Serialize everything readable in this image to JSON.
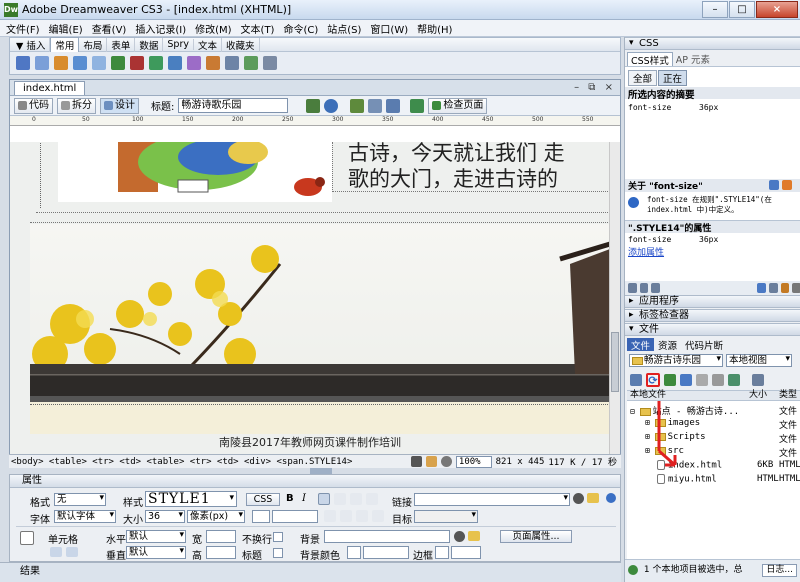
{
  "window": {
    "title": "Adobe Dreamweaver CS3 - [index.html (XHTML)]",
    "app_icon_label": "Dw",
    "minimize": "–",
    "maximize": "□",
    "close": "×"
  },
  "menu": [
    "文件(F)",
    "编辑(E)",
    "查看(V)",
    "插入记录(I)",
    "修改(M)",
    "文本(T)",
    "命令(C)",
    "站点(S)",
    "窗口(W)",
    "帮助(H)"
  ],
  "insert_panel": {
    "toggle": "▼ 插入",
    "tabs": [
      "常用",
      "布局",
      "表单",
      "数据",
      "Spry",
      "文本",
      "收藏夹"
    ],
    "active_tab": "常用"
  },
  "document": {
    "tab_name": "index.html",
    "window_controls": "– ⧉ ×",
    "view_buttons": [
      "代码",
      "拆分",
      "设计"
    ],
    "title_label": "标题:",
    "title_value": "畅游诗歌乐园",
    "check_page": "检查页面",
    "ruler_marks": [
      "0",
      "50",
      "100",
      "150",
      "200",
      "250",
      "300",
      "350",
      "400",
      "450",
      "500",
      "550"
    ],
    "heading_line1": "古诗，今天就让我们 走",
    "heading_line2": "歌的大门，走进古诗的",
    "footer_text": "南陵县2017年教师网页课件制作培训"
  },
  "status_bar": {
    "tag_path": "<body> <table> <tr> <td> <table> <tr> <td> <div> <span.STYLE14>",
    "zoom": "100%",
    "size": "821 x 445",
    "file_info": "117 K / 17 秒"
  },
  "properties": {
    "header": "属性",
    "format_label": "格式",
    "format_value": "无",
    "style_label": "样式",
    "style_value": "STYLE1",
    "css_button": "CSS",
    "bold": "B",
    "italic": "I",
    "link_label": "链接",
    "font_label": "字体",
    "font_value": "默认字体",
    "size_label": "大小",
    "size_value": "36",
    "unit_value": "像素(px)",
    "target_label": "目标",
    "cell_label": "单元格",
    "horz_label": "水平",
    "horz_value": "默认",
    "vert_label": "垂直",
    "vert_value": "默认",
    "width_label": "宽",
    "height_label": "高",
    "nowrap_label": "不换行",
    "header_label": "标题",
    "bg_label": "背景",
    "bgcolor_label": "背景颜色",
    "border_label": "边框",
    "page_props_button": "页面属性..."
  },
  "results_panel": "结果",
  "css_panel": {
    "header": "CSS",
    "tabs": [
      "CSS样式",
      "AP 元素"
    ],
    "mode_buttons": [
      "全部",
      "正在"
    ],
    "summary_title": "所选内容的摘要",
    "summary_prop": "font-size",
    "summary_val": "36px",
    "about_title": "关于 \"font-size\"",
    "about_text": "font-size 在规则\".STYLE14\"(在 index.html 中)中定义。",
    "rule_title": "\".STYLE14\"的属性",
    "rule_prop": "font-size",
    "rule_val": "36px",
    "add_property": "添加属性"
  },
  "app_panel": "应用程序",
  "tag_inspector": "标签检查器",
  "files_panel": {
    "header": "文件",
    "tabs": [
      "文件",
      "资源",
      "代码片断"
    ],
    "site_value": "畅游古诗乐园",
    "view_value": "本地视图",
    "col_local": "本地文件",
    "col_size": "大小",
    "col_type": "类型",
    "tree": [
      {
        "name": "站点 - 畅游古诗...",
        "size": "",
        "type": "文件"
      },
      {
        "name": "images",
        "size": "",
        "type": "文件"
      },
      {
        "name": "Scripts",
        "size": "",
        "type": "文件"
      },
      {
        "name": "src",
        "size": "",
        "type": "文件"
      },
      {
        "name": "index.html",
        "size": "6KB",
        "type": "HTML"
      },
      {
        "name": "miyu.html",
        "size": "6KB",
        "type": "HTML"
      }
    ],
    "status": "1 个本地项目被选中，总",
    "log_button": "日志..."
  },
  "colors": {
    "highlight_red": "#e02020",
    "selection_blue": "#316ac5"
  }
}
